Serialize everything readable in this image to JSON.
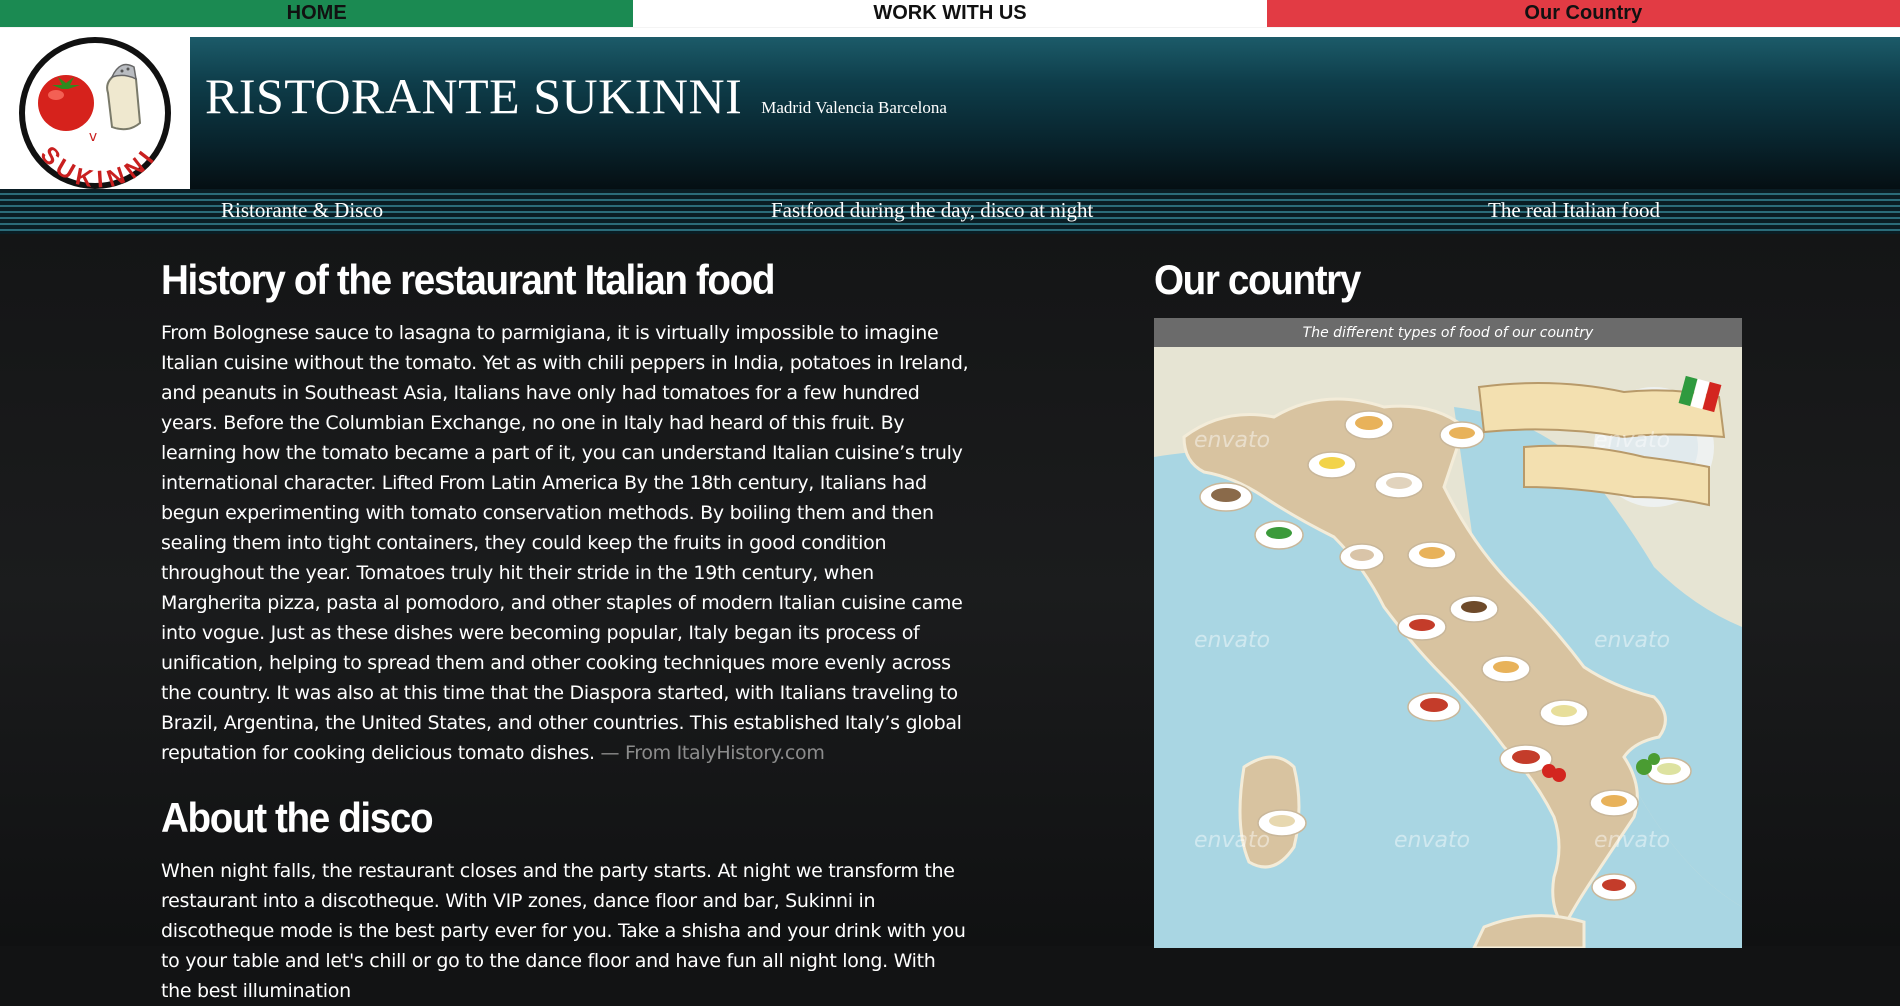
{
  "topnav": {
    "home": "HOME",
    "work": "WORK WITH US",
    "country": "Our Country"
  },
  "header": {
    "logo_text": "SUKINNI",
    "logo_small": "v",
    "title": "RISTORANTE SUKINNI",
    "cities": "Madrid Valencia Barcelona"
  },
  "subnav": {
    "item1": "Ristorante & Disco",
    "item2": "Fastfood during the day, disco at night",
    "item3": "The real Italian food"
  },
  "history": {
    "heading": "History of the restaurant Italian food",
    "text": "From Bolognese sauce to lasagna to parmigiana, it is virtually impossible to imagine Italian cuisine without the tomato. Yet as with chili peppers in India, potatoes in Ireland, and peanuts in Southeast Asia, Italians have only had tomatoes for a few hundred years. Before the Columbian Exchange, no one in Italy had heard of this fruit. By learning how the tomato became a part of it, you can understand Italian cuisine’s truly international character. Lifted From Latin America By the 18th century, Italians had begun experimenting with tomato conservation methods. By boiling them and then sealing them into tight containers, they could keep the fruits in good condition throughout the year. Tomatoes truly hit their stride in the 19th century, when Margherita pizza, pasta al pomodoro, and other staples of modern Italian cuisine came into vogue. Just as these dishes were becoming popular, Italy began its process of unification, helping to spread them and other cooking techniques more evenly across the country. It was also at this time that the Diaspora started, with Italians traveling to Brazil, Argentina, the United States, and other countries. This established Italy’s global reputation for cooking delicious tomato dishes.",
    "source": "— From ItalyHistory.com"
  },
  "disco": {
    "heading": "About the disco",
    "text": "When night falls, the restaurant closes and the party starts. At night we transform the restaurant into a discotheque. With VIP zones, dance floor and bar, Sukinni in discotheque mode is the best party ever for you. Take a shisha and your drink with you to your table and let's chill or go to the dance floor and have fun all night long. With the best illumination"
  },
  "country": {
    "heading": "Our country",
    "caption": "The different types of food of our country",
    "watermark": "envato"
  },
  "colors": {
    "nav_green": "#1b8a52",
    "nav_white": "#ffffff",
    "nav_red": "#e23b44",
    "header_teal": "#0e3d4a",
    "page_bg": "#121314"
  }
}
